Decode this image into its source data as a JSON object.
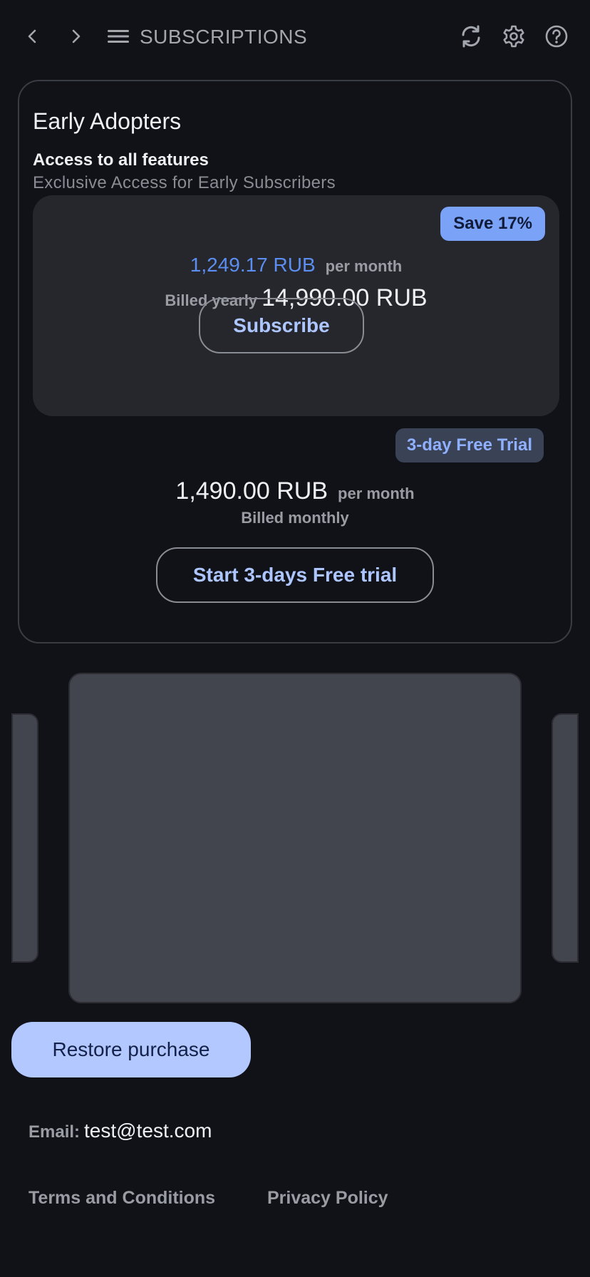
{
  "header": {
    "title": "SUBSCRIPTIONS",
    "icons": {
      "back": "chevron-left-icon",
      "forward": "chevron-right-icon",
      "menu": "hamburger-menu-icon",
      "refresh": "refresh-icon",
      "settings": "gear-icon",
      "help": "help-circle-icon"
    }
  },
  "plan": {
    "title": "Early Adopters",
    "subtitle": "Access to all features",
    "description": "Exclusive Access for Early Subscribers",
    "yearly": {
      "badge": "Save 17%",
      "price_per_month": "1,249.17 RUB",
      "per_month_label": "per month",
      "billed_label": "Billed yearly",
      "billed_amount": "14,990.00 RUB",
      "button_label": "Subscribe"
    },
    "monthly": {
      "badge": "3-day Free Trial",
      "price": "1,490.00 RUB",
      "per_month_label": "per month",
      "billed_label": "Billed monthly",
      "button_label": "Start 3-days Free trial"
    }
  },
  "restore": {
    "label": "Restore purchase"
  },
  "account": {
    "email_label": "Email:",
    "email_value": "test@test.com"
  },
  "footer": {
    "terms": "Terms and Conditions",
    "privacy": "Privacy Policy"
  },
  "colors": {
    "background": "#111218",
    "accent": "#7aa2f7",
    "price_accent": "#5b8ef0",
    "restore_button": "#b2c8ff"
  }
}
